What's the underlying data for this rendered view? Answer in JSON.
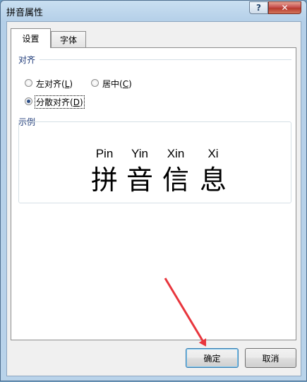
{
  "window": {
    "title": "拼音属性",
    "help": "?",
    "close": "✕"
  },
  "tabs": [
    {
      "label": "设置",
      "active": true
    },
    {
      "label": "字体",
      "active": false
    }
  ],
  "alignment": {
    "group_label": "对齐",
    "options": [
      {
        "label": "左对齐(",
        "hotkey": "L",
        "suffix": ")",
        "checked": false
      },
      {
        "label": "居中(",
        "hotkey": "C",
        "suffix": ")",
        "checked": false
      },
      {
        "label": "分散对齐(",
        "hotkey": "D",
        "suffix": ")",
        "checked": true
      }
    ]
  },
  "preview": {
    "group_label": "示例",
    "pinyin": [
      "Pin",
      "Yin",
      "Xin",
      "Xi"
    ],
    "characters": [
      "拼",
      "音",
      "信",
      "息"
    ]
  },
  "buttons": {
    "ok": "确定",
    "cancel": "取消"
  },
  "colors": {
    "annotation_arrow": "#e8363d"
  }
}
